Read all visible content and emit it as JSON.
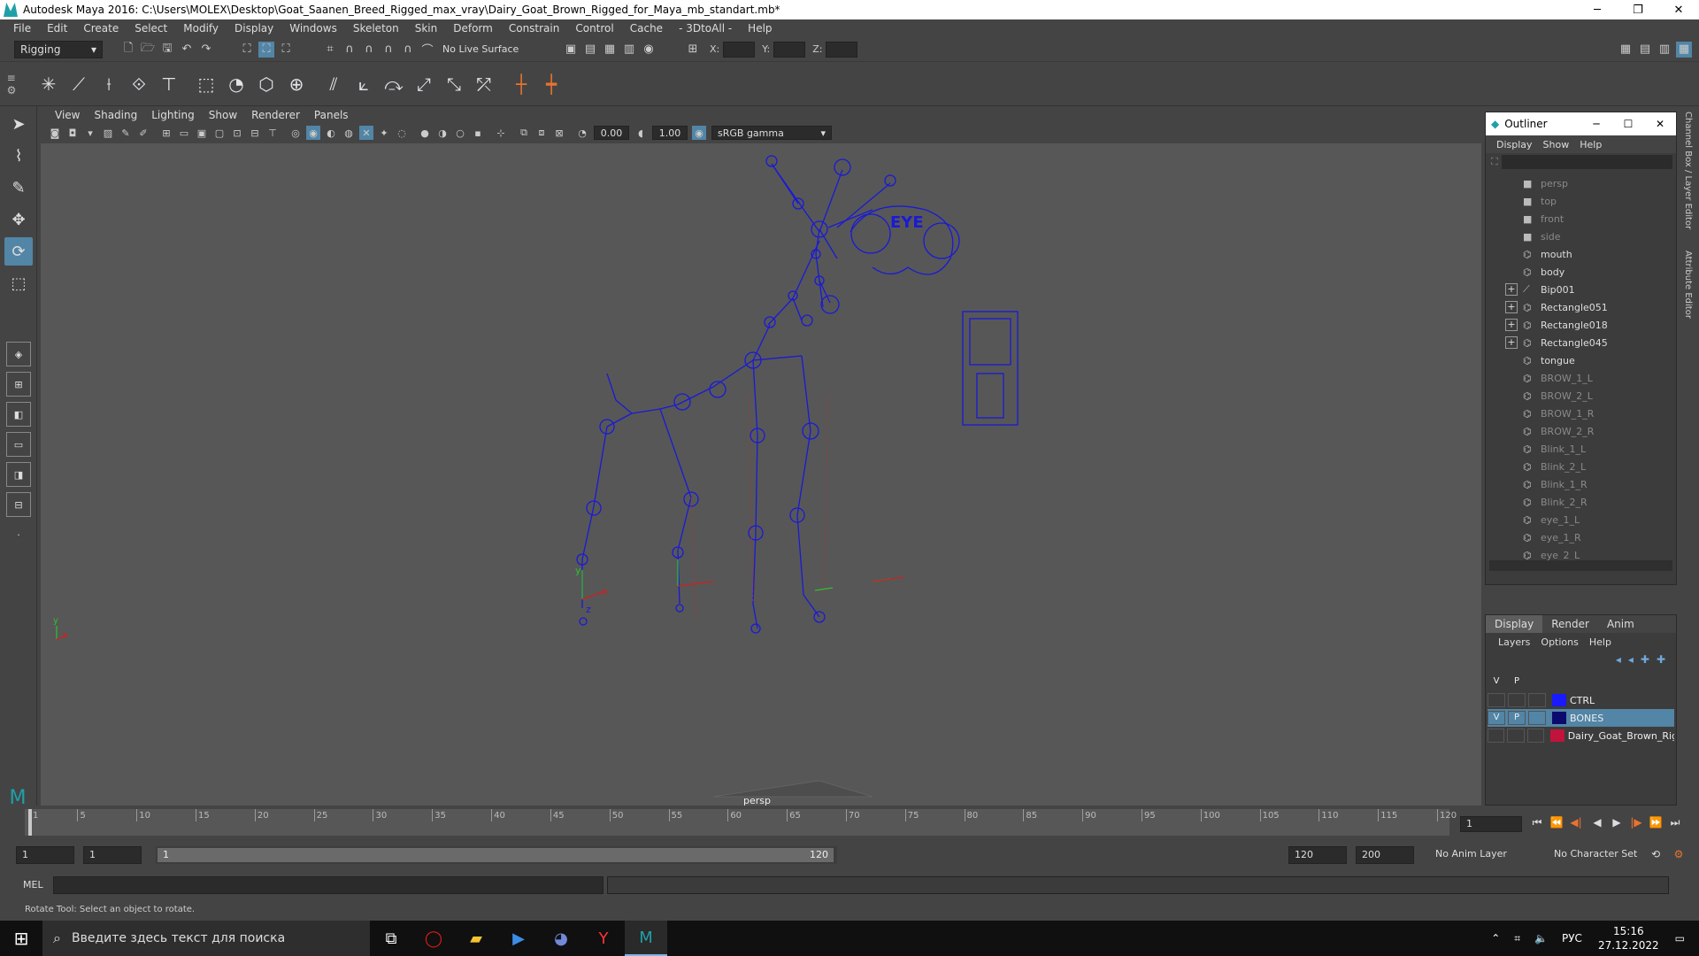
{
  "window": {
    "title": "Autodesk Maya 2016: C:\\Users\\MOLEX\\Desktop\\Goat_Saanen_Breed_Rigged_max_vray\\Dairy_Goat_Brown_Rigged_for_Maya_mb_standart.mb*",
    "minimize": "─",
    "maximize": "❐",
    "close": "✕"
  },
  "menubar": [
    "File",
    "Edit",
    "Create",
    "Select",
    "Modify",
    "Display",
    "Windows",
    "Skeleton",
    "Skin",
    "Deform",
    "Constrain",
    "Control",
    "Cache",
    "- 3DtoAll -",
    "Help"
  ],
  "statusline": {
    "menuset": "Rigging",
    "live_surface": "No Live Surface",
    "x_label": "X:",
    "y_label": "Y:",
    "z_label": "Z:"
  },
  "panel": {
    "menus": [
      "View",
      "Shading",
      "Lighting",
      "Show",
      "Renderer",
      "Panels"
    ],
    "exposure": "0.00",
    "gamma": "1.00",
    "colorspace": "sRGB gamma",
    "camera": "persp"
  },
  "outliner": {
    "title": "Outliner",
    "menus": [
      "Display",
      "Show",
      "Help"
    ],
    "items": [
      {
        "label": "persp",
        "icon": "camera-icon",
        "expandable": false,
        "dim": true
      },
      {
        "label": "top",
        "icon": "camera-icon",
        "expandable": false,
        "dim": true
      },
      {
        "label": "front",
        "icon": "camera-icon",
        "expandable": false,
        "dim": true
      },
      {
        "label": "side",
        "icon": "camera-icon",
        "expandable": false,
        "dim": true
      },
      {
        "label": "mouth",
        "icon": "transform-icon",
        "expandable": false,
        "dim": false
      },
      {
        "label": "body",
        "icon": "transform-icon",
        "expandable": false,
        "dim": false
      },
      {
        "label": "Bip001",
        "icon": "joint-icon",
        "expandable": true,
        "dim": false
      },
      {
        "label": "Rectangle051",
        "icon": "transform-icon",
        "expandable": true,
        "dim": false
      },
      {
        "label": "Rectangle018",
        "icon": "transform-icon",
        "expandable": true,
        "dim": false
      },
      {
        "label": "Rectangle045",
        "icon": "transform-icon",
        "expandable": true,
        "dim": false
      },
      {
        "label": "tongue",
        "icon": "transform-icon",
        "expandable": false,
        "dim": false
      },
      {
        "label": "BROW_1_L",
        "icon": "transform-icon",
        "expandable": false,
        "dim": true
      },
      {
        "label": "BROW_2_L",
        "icon": "transform-icon",
        "expandable": false,
        "dim": true
      },
      {
        "label": "BROW_1_R",
        "icon": "transform-icon",
        "expandable": false,
        "dim": true
      },
      {
        "label": "BROW_2_R",
        "icon": "transform-icon",
        "expandable": false,
        "dim": true
      },
      {
        "label": "Blink_1_L",
        "icon": "transform-icon",
        "expandable": false,
        "dim": true
      },
      {
        "label": "Blink_2_L",
        "icon": "transform-icon",
        "expandable": false,
        "dim": true
      },
      {
        "label": "Blink_1_R",
        "icon": "transform-icon",
        "expandable": false,
        "dim": true
      },
      {
        "label": "Blink_2_R",
        "icon": "transform-icon",
        "expandable": false,
        "dim": true
      },
      {
        "label": "eye_1_L",
        "icon": "transform-icon",
        "expandable": false,
        "dim": true
      },
      {
        "label": "eye_1_R",
        "icon": "transform-icon",
        "expandable": false,
        "dim": true
      },
      {
        "label": "eye_2_L",
        "icon": "transform-icon",
        "expandable": false,
        "dim": true
      }
    ]
  },
  "right_tabs": [
    "Channel Box / Layer Editor",
    "Attribute Editor"
  ],
  "layer_editor": {
    "tabs": [
      "Display",
      "Render",
      "Anim"
    ],
    "menus": [
      "Layers",
      "Options",
      "Help"
    ],
    "header": {
      "v": "V",
      "p": "P"
    },
    "layers": [
      {
        "v": "",
        "p": "",
        "color": "#1a1aff",
        "name": "CTRL",
        "selected": false
      },
      {
        "v": "V",
        "p": "P",
        "color": "#0b0b6e",
        "name": "BONES",
        "selected": true
      },
      {
        "v": "",
        "p": "",
        "color": "#c0143c",
        "name": "Dairy_Goat_Brown_Rig",
        "selected": false
      }
    ]
  },
  "timeline": {
    "ticks": [
      "1",
      "5",
      "10",
      "15",
      "20",
      "25",
      "30",
      "35",
      "40",
      "45",
      "50",
      "55",
      "60",
      "65",
      "70",
      "75",
      "80",
      "85",
      "90",
      "95",
      "100",
      "105",
      "110",
      "115",
      "120"
    ],
    "current_frame": "1"
  },
  "range": {
    "start": "1",
    "anim_start": "1",
    "range_start": "1",
    "range_end": "120",
    "anim_end_1": "120",
    "anim_end_2": "200",
    "anim_layer": "No Anim Layer",
    "char_set": "No Character Set"
  },
  "cmdline": {
    "label": "MEL",
    "help": "Rotate Tool: Select an object to rotate."
  },
  "viewport_labels": {
    "eye_ctrl_text": "EYE",
    "axis_x": "x",
    "axis_y": "y",
    "axis_z": "z"
  },
  "taskbar": {
    "search_placeholder": "Введите здесь текст для поиска",
    "language": "РУС",
    "time": "15:16",
    "date": "27.12.2022"
  }
}
